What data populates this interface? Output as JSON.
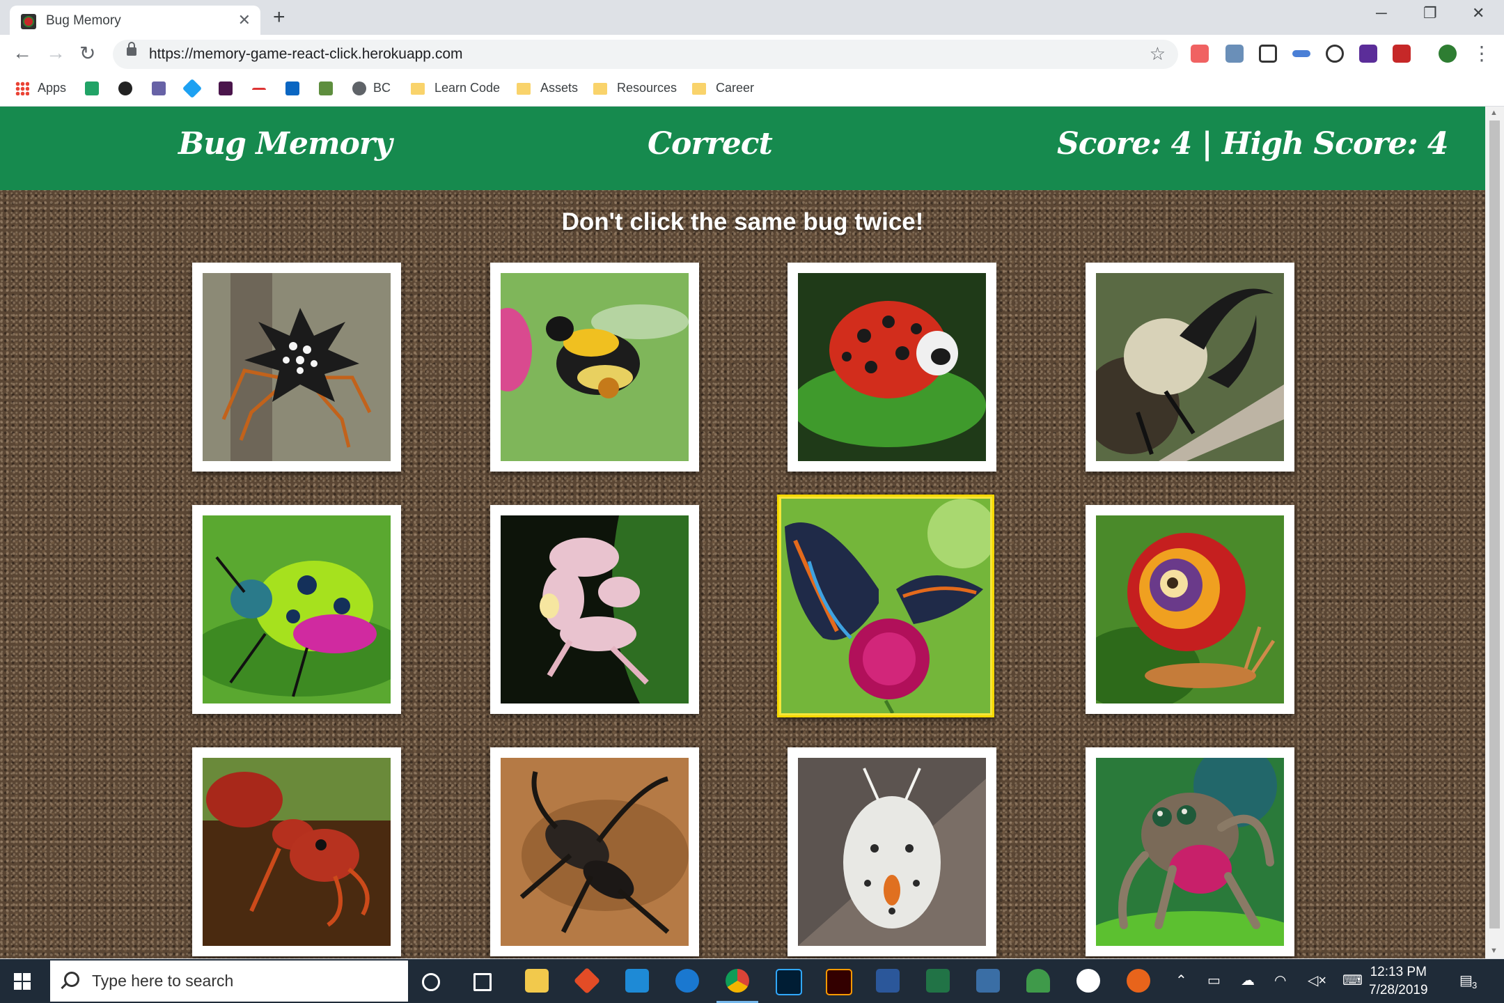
{
  "browser": {
    "tab_title": "Bug Memory",
    "tab_close": "✕",
    "new_tab": "+",
    "url": "https://memory-game-react-click.herokuapp.com",
    "bookmarks": [
      "Apps",
      "BC",
      "Learn Code",
      "Assets",
      "Resources",
      "Career"
    ]
  },
  "header": {
    "title": "Bug Memory",
    "status": "Correct",
    "score": "Score: 4 | High Score: 4"
  },
  "instruction": "Don't click the same bug twice!",
  "cards": [
    {
      "name": "spiny-orb-weaver-spider",
      "highlighted": false
    },
    {
      "name": "bumblebee",
      "highlighted": false
    },
    {
      "name": "ladybug",
      "highlighted": false
    },
    {
      "name": "hercules-beetle",
      "highlighted": false
    },
    {
      "name": "jewel-bug",
      "highlighted": false
    },
    {
      "name": "orchid-mantis",
      "highlighted": false
    },
    {
      "name": "butterfly",
      "highlighted": true
    },
    {
      "name": "snail",
      "highlighted": false
    },
    {
      "name": "bull-ant",
      "highlighted": false
    },
    {
      "name": "whip-scorpion",
      "highlighted": false
    },
    {
      "name": "white-moth-caterpillar",
      "highlighted": false
    },
    {
      "name": "jumping-spider",
      "highlighted": false
    }
  ],
  "taskbar": {
    "search_placeholder": "Type here to search",
    "time": "12:13 PM",
    "date": "7/28/2019",
    "notifications": "3"
  },
  "colors": {
    "header_green": "#168a4e",
    "highlight_yellow": "#f5e63a"
  }
}
